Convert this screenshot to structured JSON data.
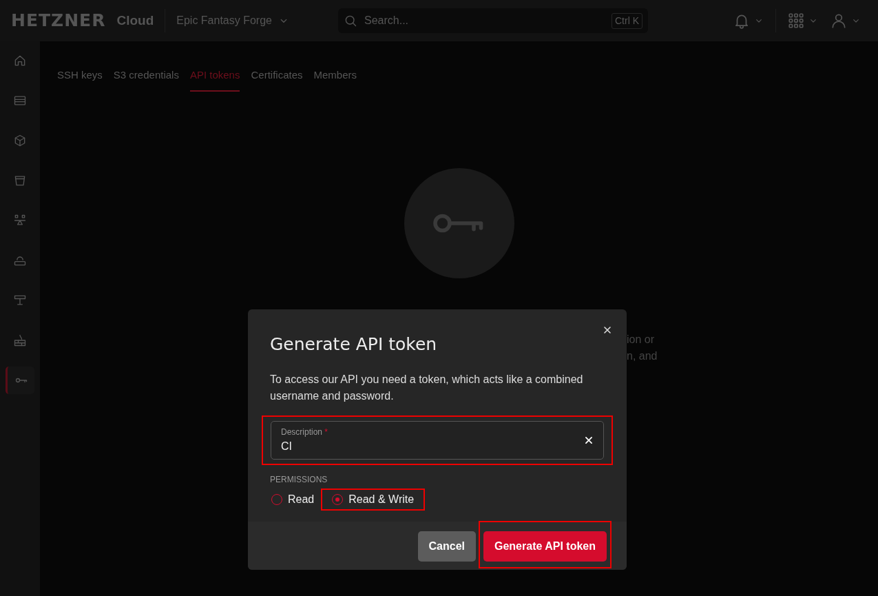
{
  "header": {
    "logo": "HETZNER",
    "product": "Cloud",
    "project": "Epic Fantasy Forge",
    "search": {
      "placeholder": "Search...",
      "shortcut": "Ctrl K"
    }
  },
  "sidebar": {
    "items": [
      {
        "kind": "home",
        "selected": false
      },
      {
        "kind": "servers",
        "selected": false
      },
      {
        "kind": "cube",
        "selected": false
      },
      {
        "kind": "bucket",
        "selected": false
      },
      {
        "kind": "balancer",
        "selected": false
      },
      {
        "kind": "cloud",
        "selected": false
      },
      {
        "kind": "network",
        "selected": false
      },
      {
        "kind": "firewall",
        "selected": false
      },
      {
        "kind": "key",
        "selected": true
      }
    ]
  },
  "tabs": [
    {
      "label": "SSH keys",
      "selected": false
    },
    {
      "label": "S3 credentials",
      "selected": false
    },
    {
      "label": "API tokens",
      "selected": true
    },
    {
      "label": "Certificates",
      "selected": false
    },
    {
      "label": "Members",
      "selected": false
    }
  ],
  "empty_state": {
    "text_fragments": [
      "ion or",
      "n, and"
    ]
  },
  "dialog": {
    "title": "Generate API token",
    "description": "To access our API you need a token, which acts like a combined username and password.",
    "field": {
      "label": "Description",
      "required_mark": "*",
      "value": "CI",
      "highlighted": true
    },
    "permissions": {
      "label": "PERMISSIONS",
      "options": [
        {
          "label": "Read",
          "selected": false,
          "highlighted": false
        },
        {
          "label": "Read & Write",
          "selected": true,
          "highlighted": true
        }
      ]
    },
    "buttons": [
      {
        "label": "Cancel",
        "kind": "secondary",
        "highlighted": false
      },
      {
        "label": "Generate API token",
        "kind": "primary",
        "highlighted": true
      }
    ]
  }
}
